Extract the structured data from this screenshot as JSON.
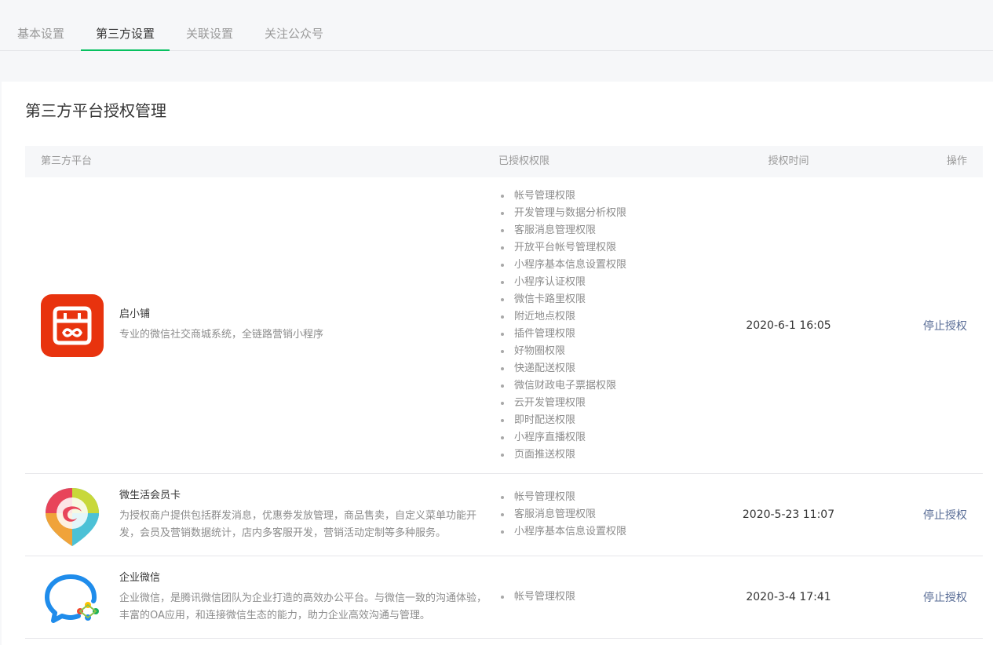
{
  "tabs": [
    "基本设置",
    "第三方设置",
    "关联设置",
    "关注公众号"
  ],
  "active_tab": 1,
  "page_title": "第三方平台授权管理",
  "columns": [
    "第三方平台",
    "已授权权限",
    "授权时间",
    "操作"
  ],
  "colors": {
    "accent": "#07c160",
    "link": "#576b95"
  },
  "apps": [
    {
      "name": "启小铺",
      "desc": "专业的微信社交商城系统，全链路营销小程序",
      "icon": "qixiaopu-logo",
      "permissions": [
        "帐号管理权限",
        "开发管理与数据分析权限",
        "客服消息管理权限",
        "开放平台帐号管理权限",
        "小程序基本信息设置权限",
        "小程序认证权限",
        "微信卡路里权限",
        "附近地点权限",
        "插件管理权限",
        "好物圈权限",
        "快递配送权限",
        "微信财政电子票据权限",
        "云开发管理权限",
        "即时配送权限",
        "小程序直播权限",
        "页面推送权限"
      ],
      "time": "2020-6-1 16:05",
      "action": "停止授权"
    },
    {
      "name": "微生活会员卡",
      "desc": "为授权商户提供包括群发消息，优惠劵发放管理，商品售卖，自定义菜单功能开发，会员及营销数据统计，店内多客服开发，营销活动定制等多种服务。",
      "icon": "weishenghuo-logo",
      "permissions": [
        "帐号管理权限",
        "客服消息管理权限",
        "小程序基本信息设置权限"
      ],
      "time": "2020-5-23 11:07",
      "action": "停止授权"
    },
    {
      "name": "企业微信",
      "desc": "企业微信，是腾讯微信团队为企业打造的高效办公平台。与微信一致的沟通体验，丰富的OA应用，和连接微信生态的能力，助力企业高效沟通与管理。",
      "icon": "wecom-logo",
      "permissions": [
        "帐号管理权限"
      ],
      "time": "2020-3-4 17:41",
      "action": "停止授权"
    }
  ]
}
